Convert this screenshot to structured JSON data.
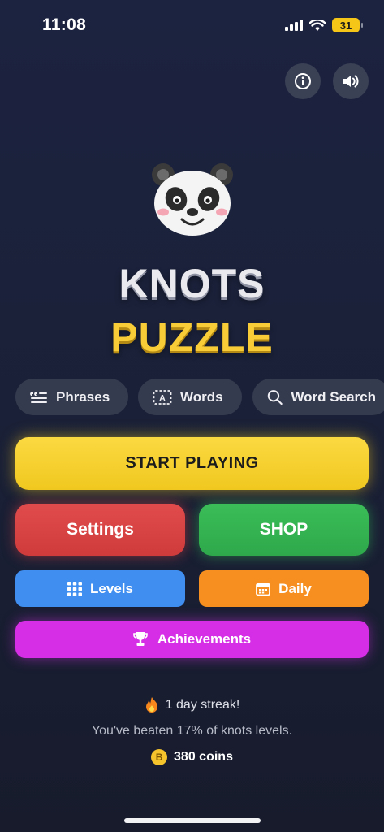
{
  "status_bar": {
    "time": "11:08",
    "battery": "31"
  },
  "header": {
    "info_icon": "info-icon",
    "sound_icon": "speaker-icon"
  },
  "logo": {
    "icon": "panda-face-icon"
  },
  "title": {
    "line1": "KNOTS",
    "line2": "PUZZLE"
  },
  "modes": [
    {
      "label": "Phrases",
      "icon": "quote-list-icon"
    },
    {
      "label": "Words",
      "icon": "letter-box-icon"
    },
    {
      "label": "Word Search",
      "icon": "search-icon"
    }
  ],
  "buttons": {
    "start": "START PLAYING",
    "settings": "Settings",
    "shop": "SHOP",
    "levels": "Levels",
    "daily": "Daily",
    "achievements": "Achievements"
  },
  "stats": {
    "streak": "1 day streak!",
    "beaten": "You've beaten 17% of knots levels.",
    "coins": "380 coins",
    "coin_symbol": "B"
  },
  "colors": {
    "start": "#f5cc2c",
    "settings": "#d94343",
    "shop": "#35b351",
    "levels": "#3f8ef0",
    "daily": "#f68f1f",
    "achievements": "#d62ee6",
    "title_accent": "#f7cc36"
  }
}
